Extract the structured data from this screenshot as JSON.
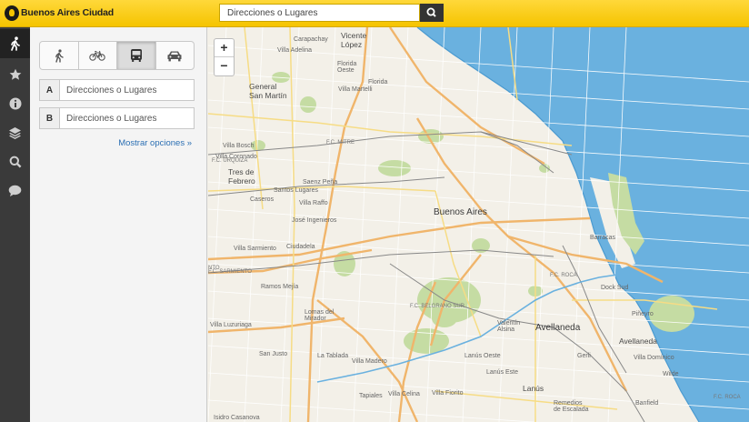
{
  "header": {
    "brand": "Buenos Aires Ciudad",
    "search_placeholder": "Direcciones o Lugares"
  },
  "rail": {
    "items": [
      {
        "icon": "walk-icon",
        "active": true
      },
      {
        "icon": "star-icon"
      },
      {
        "icon": "info-icon"
      },
      {
        "icon": "layers-icon"
      },
      {
        "icon": "search-icon"
      },
      {
        "icon": "chat-icon"
      }
    ]
  },
  "panel": {
    "modes": [
      {
        "icon": "walk-icon",
        "active": false
      },
      {
        "icon": "bicycle-icon",
        "active": false
      },
      {
        "icon": "bus-icon",
        "active": true
      },
      {
        "icon": "car-icon",
        "active": false
      }
    ],
    "origin": {
      "label": "A",
      "placeholder": "Direcciones o Lugares"
    },
    "destination": {
      "label": "B",
      "placeholder": "Direcciones o Lugares"
    },
    "more_options": "Mostrar opciones »"
  },
  "map": {
    "zoom_in": "+",
    "zoom_out": "−",
    "labels": {
      "vicente_lopez": "Vicente\nLópez",
      "carapachay": "Carapachay",
      "villa_adelina": "Villa Adelina",
      "florida_oeste": "Florida\nOeste",
      "florida": "Florida",
      "villa_martelli": "Villa Martelli",
      "general_san_martin": "General\nSan Martín",
      "villa_bosch": "Villa Bosch",
      "villa_coronado": "Villa Coronado",
      "tres_de_febrero": "Tres de\nFebrero",
      "caseros": "Caseros",
      "santos_lugares": "Santos Lugares",
      "saenz_pena": "Saenz Peña",
      "villa_raffo": "Villa Raffo",
      "jose_ingenieros": "José Ingenieros",
      "buenos_aires": "Buenos Aires",
      "villa_sarmiento": "Villa Sarmiento",
      "ciudadela": "Ciudadela",
      "ramos_mejia": "Ramos Mejía",
      "lomas_del_mirador": "Lomas del\nMirador",
      "villa_luzuriaga": "Villa Luzuriaga",
      "san_justo": "San Justo",
      "la_tablada": "La Tablada",
      "villa_madero": "Villa Madero",
      "tapiales": "Tapiales",
      "villa_celina": "Villa Celina",
      "villa_fiorito": "Villa Fiorito",
      "isidro_casanova": "Isidro Casanova",
      "valentin_alsina": "Valentín\nAlsina",
      "avellaneda": "Avellaneda",
      "avellaneda_2": "Avellaneda",
      "lanus": "Lanús",
      "lanus_oeste": "Lanús Oeste",
      "lanus_este": "Lanús Este",
      "gerli": "Gerli",
      "villa_dominico": "Villa Domínico",
      "wilde": "Wilde",
      "dock_sud": "Dock Sud",
      "remedios": "Remedios\nde Escalada",
      "barracas": "Barracas",
      "fc_belgrano_sur": "F.C. BELGRANO SUR",
      "fc_urquiza": "F.C. URQUIZA",
      "fc_mitre": "F.C. MITRE",
      "fc_roca": "F.C. ROCA",
      "fc_roca_2": "F.C. ROCA",
      "fc_sarmiento": "F.C. SARMIENTO",
      "nto": "NTO",
      "banfield": "Banfield",
      "pinar": "Piñeyro"
    }
  }
}
